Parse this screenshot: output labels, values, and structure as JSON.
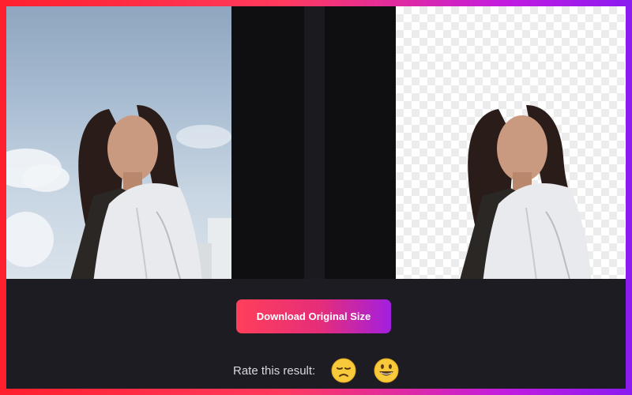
{
  "actions": {
    "download_label": "Download Original Size",
    "rate_label": "Rate this result:"
  },
  "rating": {
    "options": [
      "sad-face-icon",
      "happy-face-icon"
    ]
  },
  "colors": {
    "accent_start": "#ff3f5a",
    "accent_end": "#a21fe0",
    "background": "#1c1c22"
  }
}
